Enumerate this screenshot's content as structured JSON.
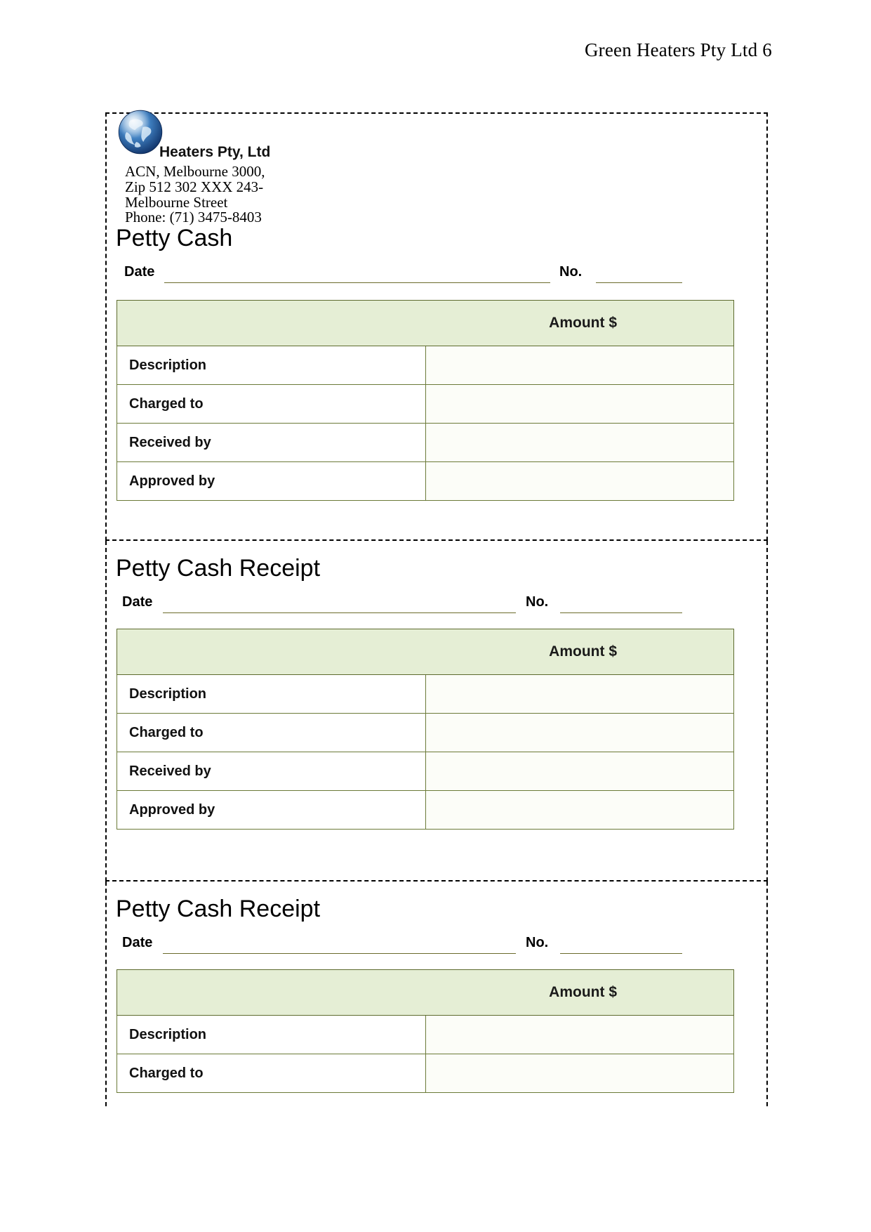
{
  "page": {
    "running_header": "Green Heaters Pty Ltd 6"
  },
  "company": {
    "logo_icon": "globe-icon",
    "name": "Heaters Pty, Ltd",
    "address_lines": [
      "ACN, Melbourne 3000,",
      "Zip 512 302 XXX 243-",
      "Melbourne Street",
      "Phone: (71) 3475-8403"
    ]
  },
  "labels": {
    "date": "Date",
    "no": "No.",
    "amount_header": "Amount $",
    "description": "Description",
    "charged_to": "Charged to",
    "received_by": "Received by",
    "approved_by": "Approved by"
  },
  "fields": {
    "date_value": "",
    "no_value": "",
    "amount_value": "",
    "description_value": "",
    "charged_to_value": "",
    "received_by_value": "",
    "approved_by_value": ""
  },
  "sections": [
    {
      "id": "petty-cash",
      "title": "Petty Cash",
      "rows": [
        "Description",
        "Charged to",
        "Received by",
        "Approved by"
      ]
    },
    {
      "id": "petty-cash-receipt-1",
      "title": "Petty Cash Receipt",
      "rows": [
        "Description",
        "Charged to",
        "Received by",
        "Approved by"
      ]
    },
    {
      "id": "petty-cash-receipt-2",
      "title": "Petty Cash Receipt",
      "rows": [
        "Description",
        "Charged to"
      ]
    }
  ],
  "colors": {
    "table_header_fill": "#e5eed5",
    "table_border": "#6b7a38",
    "rule_line": "#6b6b2b",
    "text": "#000000"
  }
}
